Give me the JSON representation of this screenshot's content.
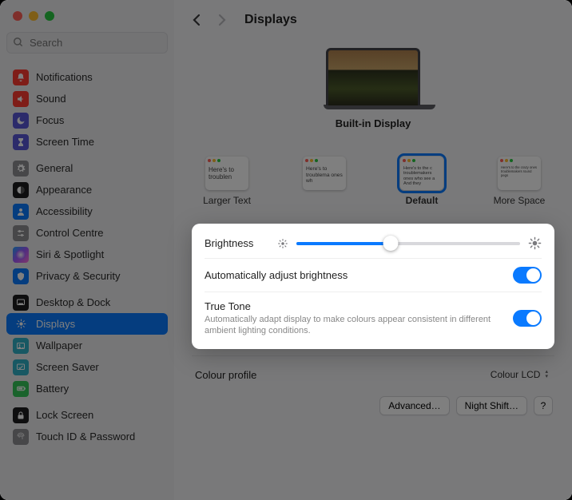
{
  "header": {
    "title": "Displays"
  },
  "search": {
    "placeholder": "Search"
  },
  "sidebar": {
    "groups": [
      [
        {
          "label": "Notifications",
          "bg": "#ff3b30",
          "glyph": "bell"
        },
        {
          "label": "Sound",
          "bg": "#ff3b30",
          "glyph": "speaker"
        },
        {
          "label": "Focus",
          "bg": "#5856d6",
          "glyph": "moon"
        },
        {
          "label": "Screen Time",
          "bg": "#5856d6",
          "glyph": "hourglass"
        }
      ],
      [
        {
          "label": "General",
          "bg": "#8e8e93",
          "glyph": "gear"
        },
        {
          "label": "Appearance",
          "bg": "#1c1c1e",
          "glyph": "appearance"
        },
        {
          "label": "Accessibility",
          "bg": "#0a7aff",
          "glyph": "person"
        },
        {
          "label": "Control Centre",
          "bg": "#8e8e93",
          "glyph": "sliders"
        },
        {
          "label": "Siri & Spotlight",
          "bg": "linear-gradient(135deg,#1fa2ff,#a259ff,#ff6fd8)",
          "glyph": "siri"
        },
        {
          "label": "Privacy & Security",
          "bg": "#0a7aff",
          "glyph": "hand"
        }
      ],
      [
        {
          "label": "Desktop & Dock",
          "bg": "#1c1c1e",
          "glyph": "dock"
        },
        {
          "label": "Displays",
          "bg": "#0a7aff",
          "glyph": "sun",
          "selected": true
        },
        {
          "label": "Wallpaper",
          "bg": "#30b0c7",
          "glyph": "wall"
        },
        {
          "label": "Screen Saver",
          "bg": "#30b0c7",
          "glyph": "ssaver"
        },
        {
          "label": "Battery",
          "bg": "#34c759",
          "glyph": "battery"
        }
      ],
      [
        {
          "label": "Lock Screen",
          "bg": "#1c1c1e",
          "glyph": "lock"
        },
        {
          "label": "Touch ID & Password",
          "bg": "#8e8e93",
          "glyph": "finger"
        }
      ]
    ]
  },
  "display": {
    "name": "Built-in Display",
    "resolutions": [
      {
        "label": "Larger Text",
        "sample": "Here's to troublen"
      },
      {
        "label": "",
        "sample": "Here's to troublema ones wh"
      },
      {
        "label": "Default",
        "sample": "Here's to the c troublemakers ones who see a And they",
        "selected": true
      },
      {
        "label": "More Space",
        "sample": "Here's to the crazy ones troublemakers round pegs"
      }
    ]
  },
  "panel": {
    "brightness_label": "Brightness",
    "brightness_pct": 42,
    "auto_label": "Automatically adjust brightness",
    "auto_on": true,
    "tt_label": "True Tone",
    "tt_desc": "Automatically adapt display to make colours appear consistent in different ambient lighting conditions.",
    "tt_on": true
  },
  "colour": {
    "label": "Colour profile",
    "value": "Colour LCD"
  },
  "footer": {
    "advanced": "Advanced…",
    "night": "Night Shift…",
    "help": "?"
  }
}
